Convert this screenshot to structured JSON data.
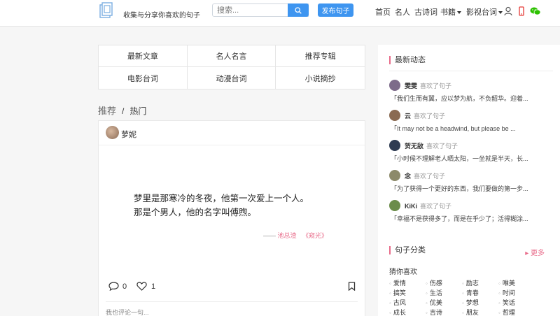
{
  "header": {
    "slogan": "收集与分享你喜欢的句子",
    "search_placeholder": "搜索...",
    "publish_label": "发布句子",
    "nav": [
      {
        "label": "首页",
        "dropdown": false
      },
      {
        "label": "名人",
        "dropdown": false
      },
      {
        "label": "古诗词",
        "dropdown": false
      },
      {
        "label": "书籍",
        "dropdown": true
      },
      {
        "label": "影视台词",
        "dropdown": true
      }
    ],
    "colors": {
      "accent": "#3e95f0",
      "mobile_icon": "#e53935",
      "wechat_icon": "#2dc100"
    },
    "icons": [
      "user-icon",
      "mobile-icon",
      "wechat-icon"
    ]
  },
  "categories": [
    "最新文章",
    "名人名言",
    "推荐专辑",
    "电影台词",
    "动漫台词",
    "小说摘抄"
  ],
  "tabs": {
    "recommend": "推荐",
    "separator": "/",
    "hot": "热门"
  },
  "post": {
    "author": "萝妮",
    "quote_line1": "梦里是那寒冷的冬夜，他第一次爱上一个人。",
    "quote_line2": "那是个男人，他的名字叫傅煦。",
    "source_dash": "——",
    "source_author": "池总渣",
    "source_book": "《窥光》",
    "comment_count": "0",
    "like_count": "1",
    "comment_placeholder": "我也评论一句..."
  },
  "sidebar": {
    "latest_title": "最新动态",
    "liked_text": "喜欢了句子",
    "activity": [
      {
        "name": "雯雯",
        "text": "「我们生而有翼，应以梦为航，不负韶华。迎着...",
        "avatar_color": "#7d6b8a"
      },
      {
        "name": "云",
        "text": "「It may not be a headwind, but please be ...",
        "avatar_color": "#8a6a52"
      },
      {
        "name": "贺无敌",
        "text": "「小时候不理解老人晒太阳，一坐就是半天，长...",
        "avatar_color": "#2f3b52"
      },
      {
        "name": "念",
        "text": "「为了获得一个更好的东西，我们要做的第一步...",
        "avatar_color": "#8c8a6a"
      },
      {
        "name": "KiKi",
        "text": "「幸福不是获得多了，而是在乎少了；活得糊涂...",
        "avatar_color": "#6b8c4a"
      }
    ],
    "category_title": "句子分类",
    "more_label": "更多",
    "guess_label": "猜你喜欢",
    "tags": [
      "爱情",
      "伤感",
      "励志",
      "唯美",
      "搞笑",
      "生活",
      "青春",
      "时间",
      "古风",
      "优美",
      "梦想",
      "笑话",
      "成长",
      "吉诗",
      "朋友",
      "哲理"
    ],
    "accent": "#e86b8a"
  }
}
